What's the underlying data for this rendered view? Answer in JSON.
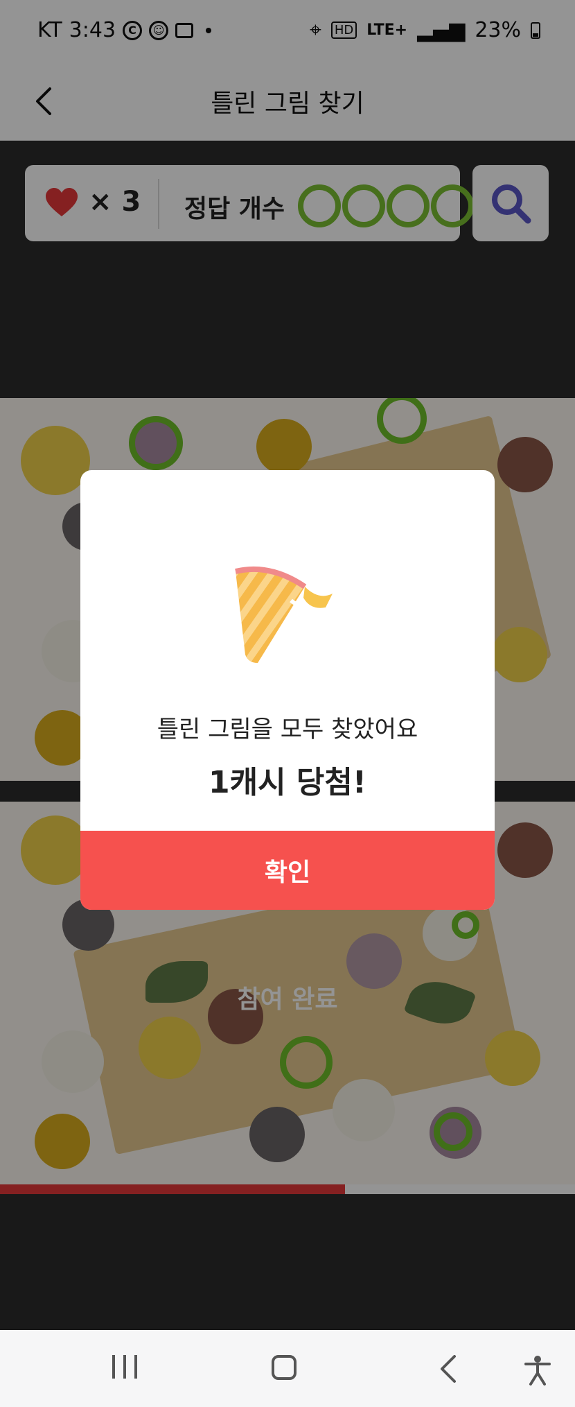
{
  "status_bar": {
    "carrier": "KT",
    "time": "3:43",
    "network": "LTE+",
    "battery": "23%"
  },
  "header": {
    "title": "틀린 그림 찾기"
  },
  "game": {
    "lives_text": "× 3",
    "answer_label": "정답 개수",
    "answers_total": 5,
    "answers_found": 5,
    "participation_text": "참여 완료",
    "progress_ratio": 0.6
  },
  "modal": {
    "message": "틀린 그림을 모두 찾았어요",
    "prize": "1캐시 당첨!",
    "confirm_label": "확인"
  },
  "colors": {
    "accent_red": "#f6514e",
    "ring_green": "#7bbf32",
    "heart_red": "#e5373a",
    "search_icon": "#5b57c7"
  },
  "icons": {
    "back": "back-arrow-icon",
    "heart": "heart-icon",
    "search": "search-icon",
    "party": "party-popper-icon"
  }
}
